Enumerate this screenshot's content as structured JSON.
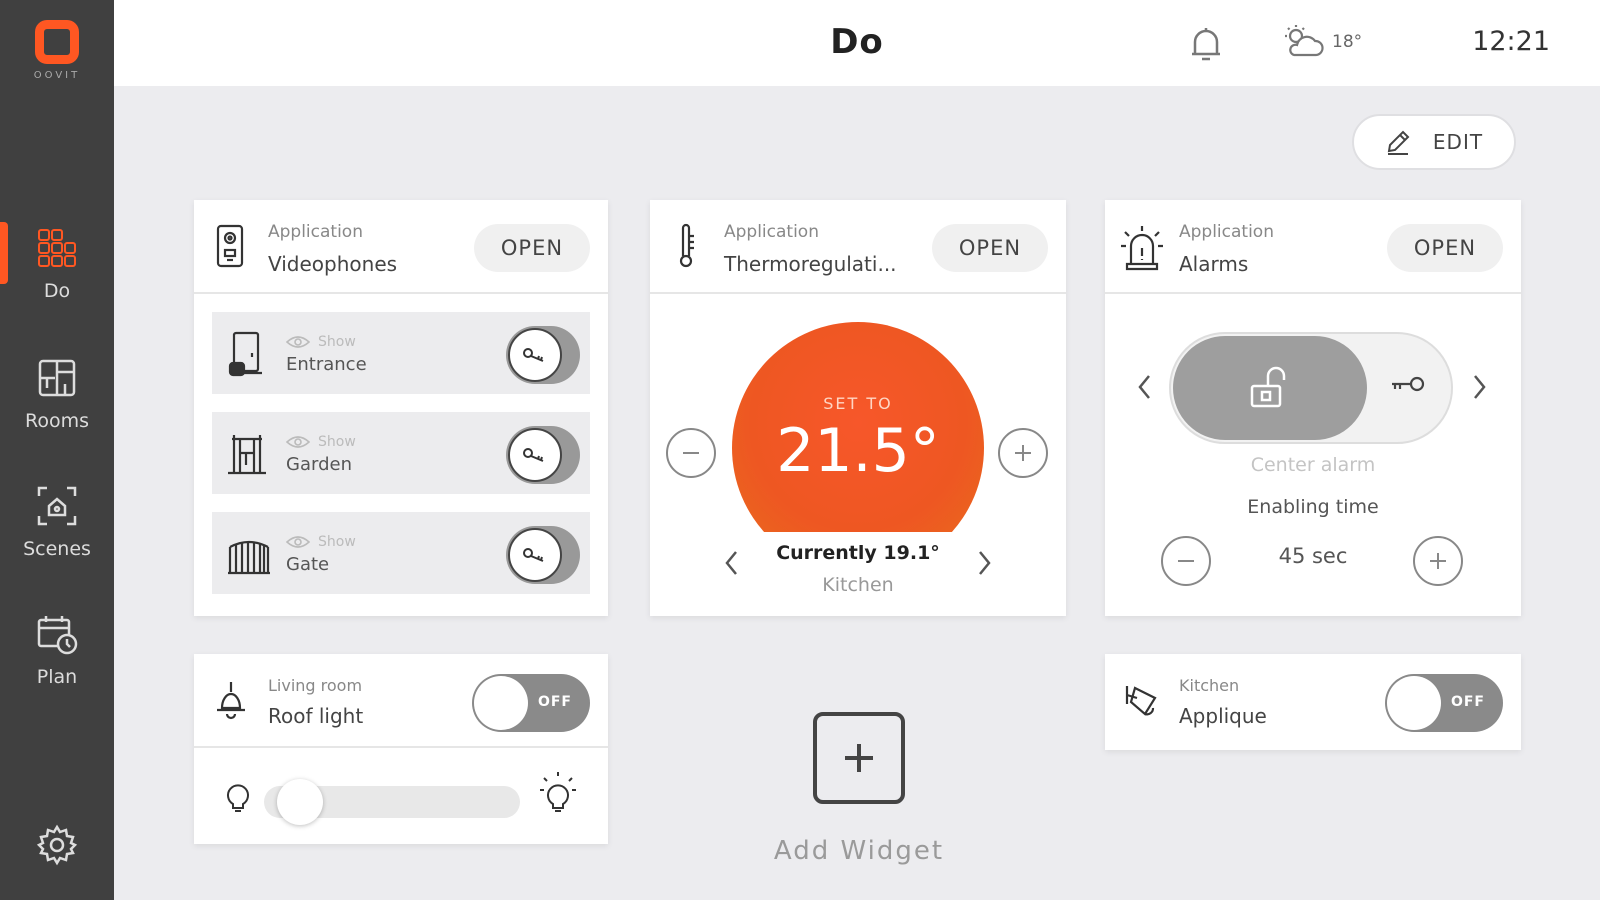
{
  "brand": {
    "logo_text": "OOVIT",
    "accent": "#ff5722"
  },
  "sidebar": {
    "items": [
      {
        "label": "Do",
        "icon": "grid-icon",
        "active": true
      },
      {
        "label": "Rooms",
        "icon": "rooms-icon",
        "active": false
      },
      {
        "label": "Scenes",
        "icon": "scenes-icon",
        "active": false
      },
      {
        "label": "Plan",
        "icon": "calendar-clock-icon",
        "active": false
      }
    ],
    "settings_icon": "gear-icon"
  },
  "header": {
    "title": "Do",
    "weather_temp": "18°",
    "time": "12:21"
  },
  "edit_label": "EDIT",
  "widgets": {
    "videophones": {
      "category": "Application",
      "title": "Videophones",
      "open_label": "OPEN",
      "rows": [
        {
          "show_label": "Show",
          "name": "Entrance"
        },
        {
          "show_label": "Show",
          "name": "Garden"
        },
        {
          "show_label": "Show",
          "name": "Gate"
        }
      ]
    },
    "thermo": {
      "category": "Application",
      "title": "Thermoregulati...",
      "open_label": "OPEN",
      "set_to_label": "SET TO",
      "set_value": "21.5°",
      "currently": "Currently 19.1°",
      "room": "Kitchen"
    },
    "alarms": {
      "category": "Application",
      "title": "Alarms",
      "open_label": "OPEN",
      "center_label": "Center alarm",
      "enabling_label": "Enabling time",
      "time_value": "45 sec"
    },
    "roof_light": {
      "category": "Living room",
      "title": "Roof light",
      "state_label": "OFF",
      "dimmer_level": 0.06
    },
    "applique": {
      "category": "Kitchen",
      "title": "Applique",
      "state_label": "OFF"
    }
  },
  "add_widget_label": "Add Widget"
}
